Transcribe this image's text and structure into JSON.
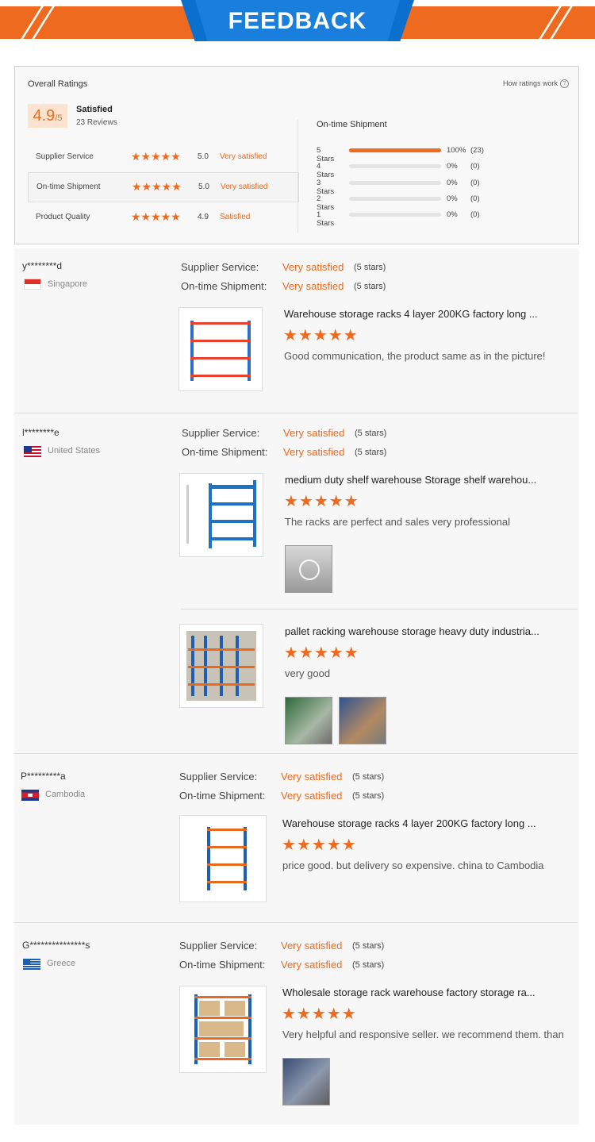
{
  "banner": {
    "title": "FEEDBACK"
  },
  "summary": {
    "title": "Overall Ratings",
    "how_link": "How ratings work",
    "how_icon": "?",
    "score": "4.9",
    "score_denominator": "/5",
    "satisfaction": "Satisfied",
    "review_count": "23 Reviews",
    "star_glyphs": "★★★★★",
    "metrics": [
      {
        "name": "Supplier Service",
        "value": "5.0",
        "level": "Very satisfied"
      },
      {
        "name": "On-time Shipment",
        "value": "5.0",
        "level": "Very satisfied"
      },
      {
        "name": "Product Quality",
        "value": "4.9",
        "level": "Satisfied"
      }
    ],
    "distribution_title": "On-time Shipment",
    "distribution": [
      {
        "label": "5 Stars",
        "fraction": 1.0,
        "percent": "100%",
        "count": "(23)"
      },
      {
        "label": "4 Stars",
        "fraction": 0,
        "percent": "0%",
        "count": "(0)"
      },
      {
        "label": "3 Stars",
        "fraction": 0,
        "percent": "0%",
        "count": "(0)"
      },
      {
        "label": "2 Stars",
        "fraction": 0,
        "percent": "0%",
        "count": "(0)"
      },
      {
        "label": "1 Stars",
        "fraction": 0,
        "percent": "0%",
        "count": "(0)"
      }
    ]
  },
  "colors": {
    "accent": "#ee6a1e",
    "banner_blue": "#0a6fcd"
  },
  "reviews": [
    {
      "user": "y********d",
      "country": "Singapore",
      "supplier_label": "Supplier Service:",
      "supplier_value": "Very satisfied",
      "supplier_stars": "(5 stars)",
      "shipment_label": "On-time Shipment:",
      "shipment_value": "Very satisfied",
      "shipment_stars": "(5 stars)",
      "products": [
        {
          "title": "Warehouse storage racks 4 layer 200KG factory long ...",
          "stars": "★★★★★",
          "comment": "Good communication, the product same as in the picture!"
        }
      ]
    },
    {
      "user": "l********e",
      "country": "United States",
      "supplier_label": "Supplier Service:",
      "supplier_value": "Very satisfied",
      "supplier_stars": "(5 stars)",
      "shipment_label": "On-time Shipment:",
      "shipment_value": "Very satisfied",
      "shipment_stars": "(5 stars)",
      "products": [
        {
          "title": "medium duty shelf warehouse Storage shelf warehou...",
          "stars": "★★★★★",
          "comment": "The racks are perfect and sales very professional"
        },
        {
          "title": "pallet racking warehouse storage heavy duty industria...",
          "stars": "★★★★★",
          "comment": "very good"
        }
      ]
    },
    {
      "user": "P*********a",
      "country": "Cambodia",
      "supplier_label": "Supplier Service:",
      "supplier_value": "Very satisfied",
      "supplier_stars": "(5 stars)",
      "shipment_label": "On-time Shipment:",
      "shipment_value": "Very satisfied",
      "shipment_stars": "(5 stars)",
      "products": [
        {
          "title": "Warehouse storage racks 4 layer 200KG factory long ...",
          "stars": "★★★★★",
          "comment": "price good. but delivery so expensive. china to Cambodia"
        }
      ]
    },
    {
      "user": "G***************s",
      "country": "Greece",
      "supplier_label": "Supplier Service:",
      "supplier_value": "Very satisfied",
      "supplier_stars": "(5 stars)",
      "shipment_label": "On-time Shipment:",
      "shipment_value": "Very satisfied",
      "shipment_stars": "(5 stars)",
      "products": [
        {
          "title": "Wholesale storage rack warehouse factory storage ra...",
          "stars": "★★★★★",
          "comment": "Very helpful and responsive seller. we recommend them. than"
        }
      ]
    }
  ]
}
